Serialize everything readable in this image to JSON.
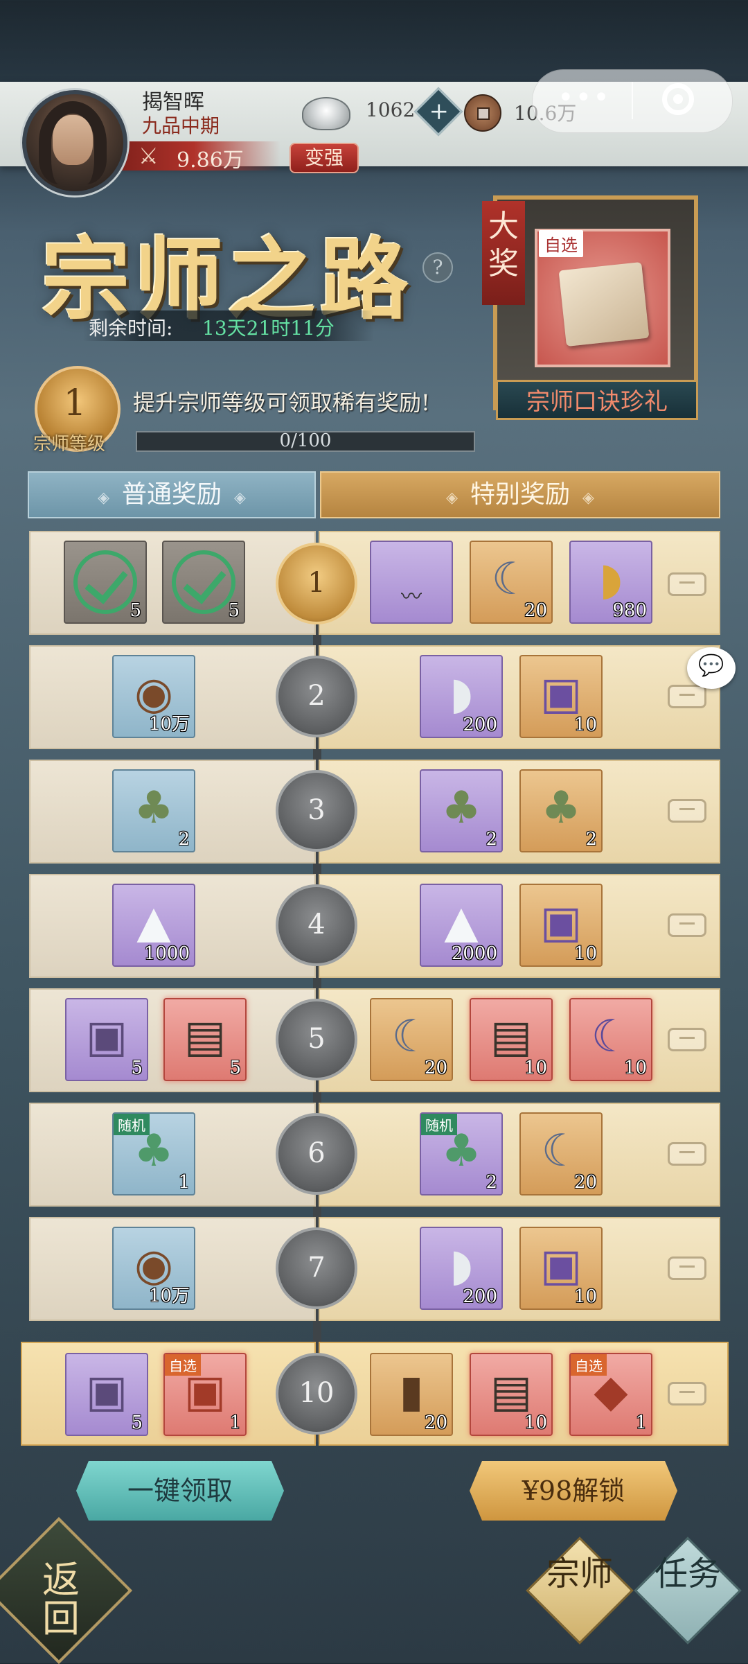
{
  "player": {
    "name": "揭智晖",
    "rank": "九品中期",
    "power": "9.86万",
    "strengthen_label": "变强"
  },
  "currency": {
    "silver": "1062",
    "coins": "10.6万",
    "plus": "+"
  },
  "event": {
    "title": "宗师之路",
    "help": "?",
    "timer_label": "剩余时间:",
    "timer_value": "13天21时11分"
  },
  "grand_prize": {
    "flag": "大奖",
    "tag": "自选",
    "name": "宗师口诀珍礼"
  },
  "level": {
    "value": "1",
    "label": "宗师等级",
    "hint": "提升宗师等级可领取稀有奖励!",
    "exp": "0/100"
  },
  "tabs": {
    "normal": "普通奖励",
    "special": "特别奖励",
    "ornament": "◈"
  },
  "rows": [
    {
      "level": "1",
      "normal": [
        {
          "qty": "5"
        },
        {
          "qty": "5"
        }
      ],
      "special": [
        {
          "qty": ""
        },
        {
          "qty": "20"
        },
        {
          "qty": "980"
        }
      ]
    },
    {
      "level": "2",
      "normal": [
        {
          "qty": "10万"
        }
      ],
      "special": [
        {
          "qty": "200"
        },
        {
          "qty": "10"
        }
      ]
    },
    {
      "level": "3",
      "normal": [
        {
          "qty": "2"
        }
      ],
      "special": [
        {
          "qty": "2"
        },
        {
          "qty": "2"
        }
      ]
    },
    {
      "level": "4",
      "normal": [
        {
          "qty": "1000"
        }
      ],
      "special": [
        {
          "qty": "2000"
        },
        {
          "qty": "10"
        }
      ]
    },
    {
      "level": "5",
      "normal": [
        {
          "qty": "5"
        },
        {
          "qty": "5"
        }
      ],
      "special": [
        {
          "qty": "20"
        },
        {
          "qty": "10"
        },
        {
          "qty": "10"
        }
      ]
    },
    {
      "level": "6",
      "normal": [
        {
          "qty": "1",
          "tag": "随机"
        }
      ],
      "special": [
        {
          "qty": "2",
          "tag": "随机"
        },
        {
          "qty": "20"
        }
      ]
    },
    {
      "level": "7",
      "normal": [
        {
          "qty": "10万"
        }
      ],
      "special": [
        {
          "qty": "200"
        },
        {
          "qty": "10"
        }
      ]
    },
    {
      "level": "10",
      "normal": [
        {
          "qty": "5"
        },
        {
          "qty": "1",
          "tag": "自选"
        }
      ],
      "special": [
        {
          "qty": "20"
        },
        {
          "qty": "10"
        },
        {
          "qty": "1",
          "tag": "自选"
        }
      ]
    }
  ],
  "buttons": {
    "claim_all": "一键领取",
    "unlock": "¥98解锁",
    "back": "返回",
    "master": "宗师",
    "task": "任务"
  },
  "capsule": {
    "more": "•••"
  },
  "colors": {
    "accent_gold": "#d6a857",
    "accent_teal": "#4aa8a3",
    "timer_green": "#65e2a4"
  }
}
